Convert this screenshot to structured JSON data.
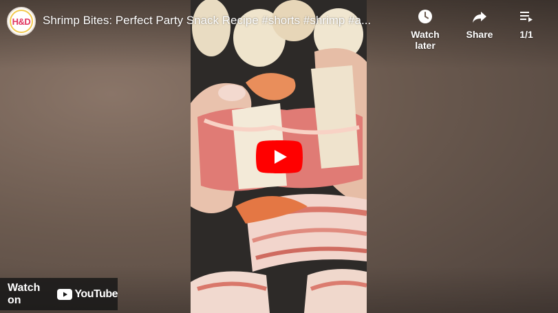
{
  "video": {
    "title": "Shrimp Bites: Perfect Party Snack Recipe #shorts #shrimp #a..."
  },
  "channel": {
    "avatar_text": "H&D",
    "avatar_icon": "channel-logo-icon"
  },
  "actions": {
    "watch_later_label": "Watch later",
    "share_label": "Share",
    "playlist_label": "1/1"
  },
  "footer": {
    "watch_on_label": "Watch on",
    "youtube_label": "YouTube"
  },
  "colors": {
    "play_red": "#ff0000",
    "overlay_bg": "#171717",
    "text": "#ffffff"
  }
}
